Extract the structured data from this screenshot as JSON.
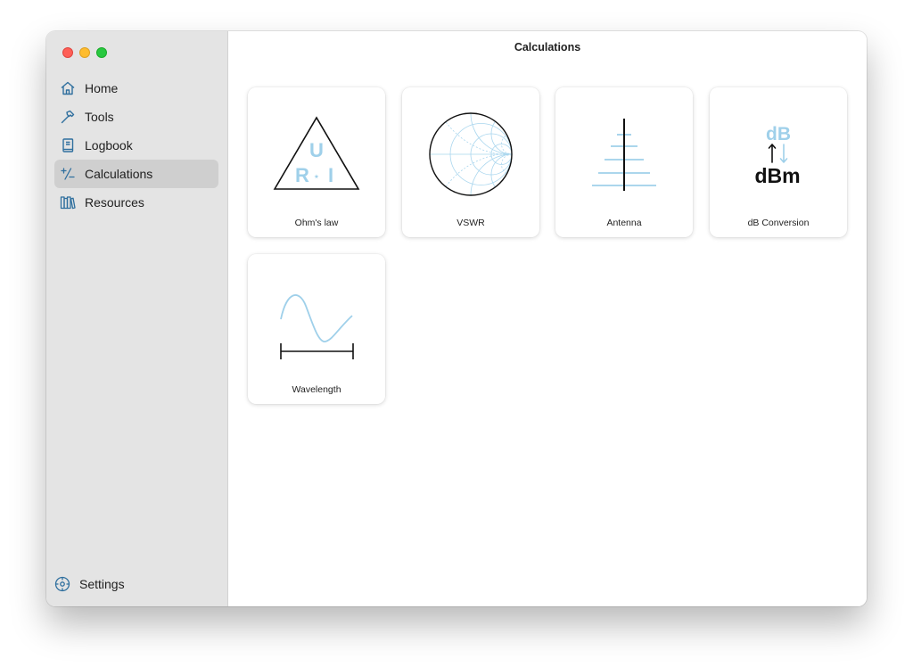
{
  "window": {
    "title": "Calculations"
  },
  "sidebar": {
    "items": [
      {
        "label": "Home",
        "icon": "house-icon"
      },
      {
        "label": "Tools",
        "icon": "hammer-icon"
      },
      {
        "label": "Logbook",
        "icon": "book-icon"
      },
      {
        "label": "Calculations",
        "icon": "plus-minus-icon",
        "active": true
      },
      {
        "label": "Resources",
        "icon": "books-icon"
      }
    ],
    "settings_label": "Settings"
  },
  "cards": [
    {
      "label": "Ohm's law",
      "art": {
        "top": "U",
        "left": "R",
        "mid": "⋆",
        "right": "I"
      }
    },
    {
      "label": "VSWR"
    },
    {
      "label": "Antenna"
    },
    {
      "label": "dB Conversion",
      "art": {
        "top": "dB",
        "arrows": "↑↓",
        "bottom": "dBm"
      }
    },
    {
      "label": "Wavelength"
    }
  ],
  "colors": {
    "accent": "#2f6f9e",
    "light_blue": "#9fd0ea",
    "sidebar_bg": "#e4e4e4",
    "selected_bg": "#cfcfcf"
  }
}
